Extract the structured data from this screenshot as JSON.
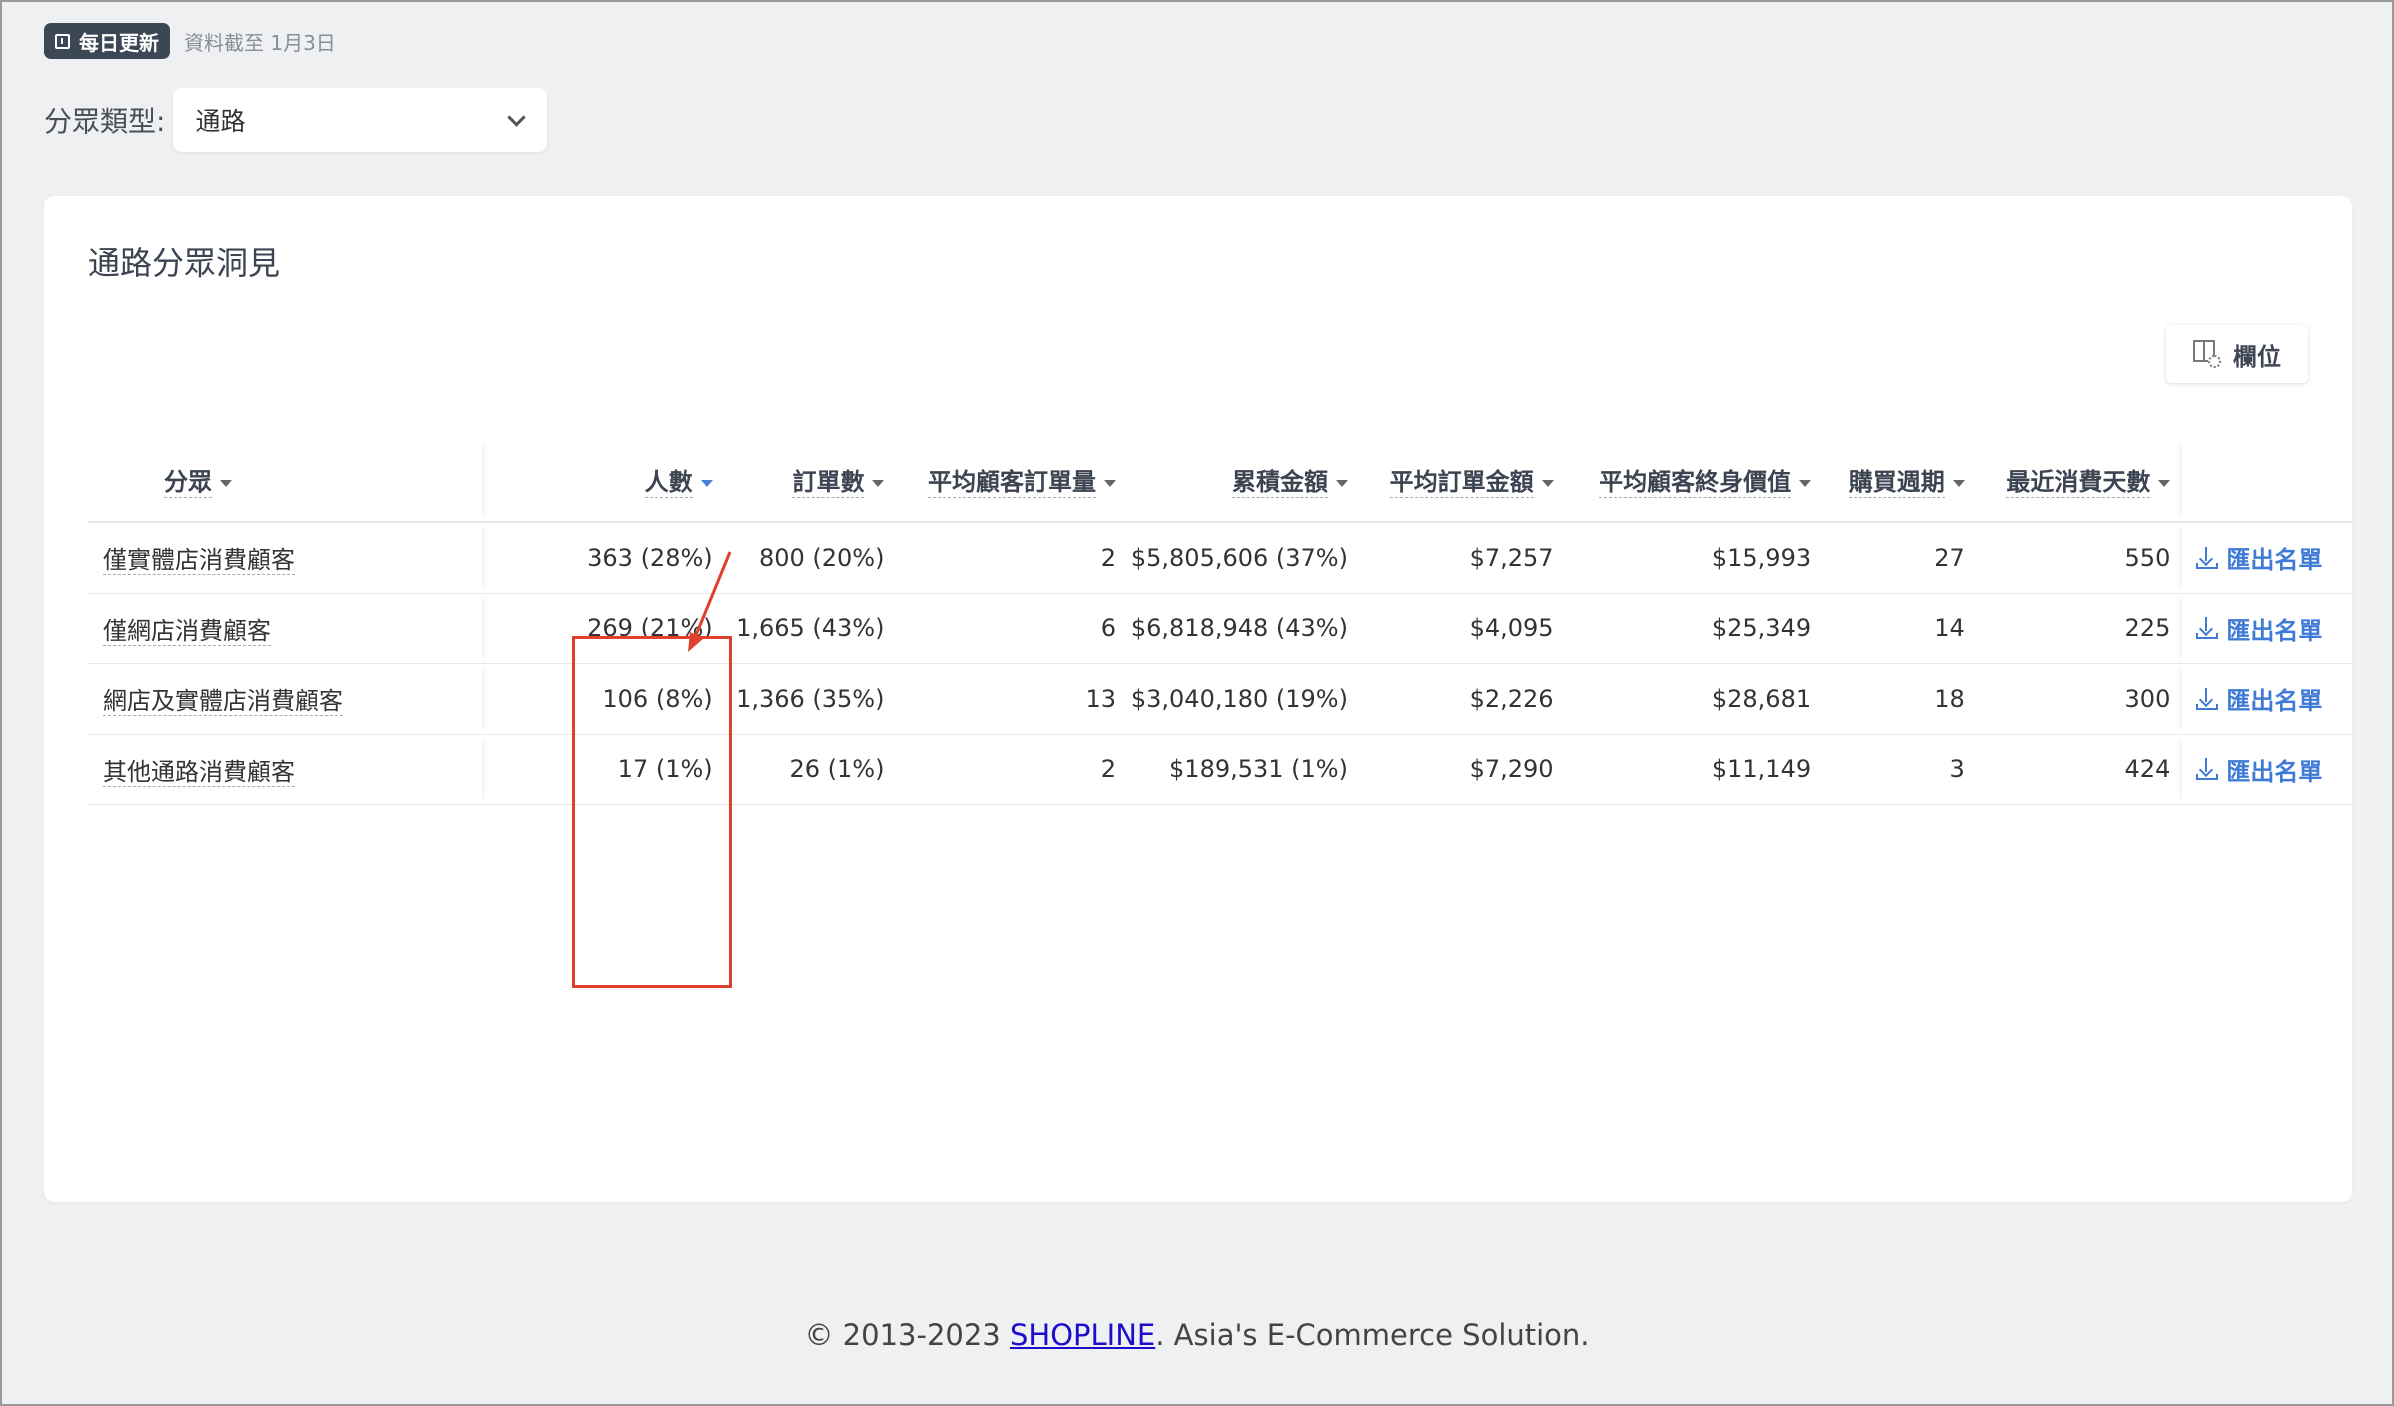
{
  "top": {
    "badge_label": "每日更新",
    "cutoff_text": "資料截至 1月3日"
  },
  "filter": {
    "label": "分眾類型:",
    "selected": "通路"
  },
  "card": {
    "title": "通路分眾洞見",
    "columns_button": "欄位"
  },
  "table": {
    "headers": {
      "segment": "分眾",
      "people": "人數",
      "orders": "訂單數",
      "avg_orders": "平均顧客訂單量",
      "total_amount": "累積金額",
      "avg_order_amount": "平均訂單金額",
      "ltv": "平均顧客終身價值",
      "cycle": "購買週期",
      "recency": "最近消費天數"
    },
    "rows": [
      {
        "segment": "僅實體店消費顧客",
        "people": "363 (28%)",
        "orders": "800 (20%)",
        "avg_orders": "2",
        "total_amount": "$5,805,606 (37%)",
        "avg_order_amount": "$7,257",
        "ltv": "$15,993",
        "cycle": "27",
        "recency": "550",
        "export": "匯出名單"
      },
      {
        "segment": "僅網店消費顧客",
        "people": "269 (21%)",
        "orders": "1,665 (43%)",
        "avg_orders": "6",
        "total_amount": "$6,818,948 (43%)",
        "avg_order_amount": "$4,095",
        "ltv": "$25,349",
        "cycle": "14",
        "recency": "225",
        "export": "匯出名單"
      },
      {
        "segment": "網店及實體店消費顧客",
        "people": "106 (8%)",
        "orders": "1,366 (35%)",
        "avg_orders": "13",
        "total_amount": "$3,040,180 (19%)",
        "avg_order_amount": "$2,226",
        "ltv": "$28,681",
        "cycle": "18",
        "recency": "300",
        "export": "匯出名單"
      },
      {
        "segment": "其他通路消費顧客",
        "people": "17 (1%)",
        "orders": "26 (1%)",
        "avg_orders": "2",
        "total_amount": "$189,531 (1%)",
        "avg_order_amount": "$7,290",
        "ltv": "$11,149",
        "cycle": "3",
        "recency": "424",
        "export": "匯出名單"
      }
    ]
  },
  "footer": {
    "prefix": "© 2013-2023 ",
    "link": "SHOPLINE",
    "suffix": ". Asia's E-Commerce Solution."
  },
  "colors": {
    "accent": "#3f7bd6",
    "highlight": "#e0412d",
    "badge": "#3c4756"
  }
}
